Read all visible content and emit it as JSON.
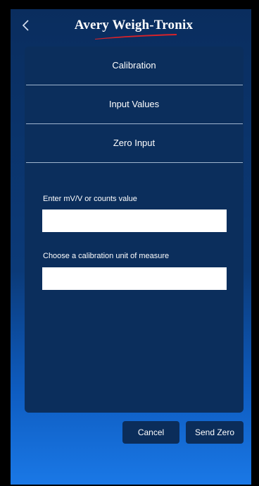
{
  "header": {
    "back_icon": "chevron-left-icon",
    "logo_text": "Avery Weigh-Tronix",
    "brand_accent": "#d8232a"
  },
  "menu": {
    "items": [
      {
        "label": "Calibration"
      },
      {
        "label": "Input Values"
      },
      {
        "label": "Zero Input"
      }
    ]
  },
  "form": {
    "mv_label": "Enter mV/V or counts value",
    "mv_value": "",
    "unit_label": "Choose a calibration unit of measure",
    "unit_value": ""
  },
  "actions": {
    "cancel_label": "Cancel",
    "send_zero_label": "Send Zero"
  }
}
